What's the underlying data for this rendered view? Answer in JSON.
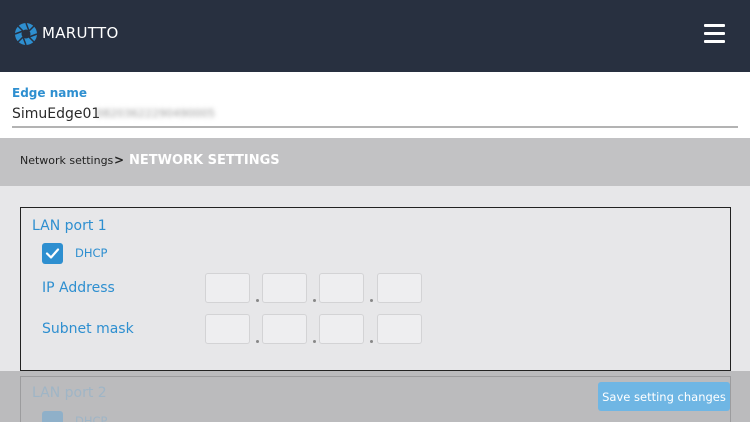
{
  "header": {
    "brand": "MARUTTO",
    "logo_icon": "aperture-logo-icon",
    "menu_icon": "hamburger-menu-icon",
    "bg_color": "#283040"
  },
  "edge": {
    "label": "Edge name",
    "name": "SimuEdge01",
    "id_masked": "08203622290490005"
  },
  "breadcrumb": {
    "link": "Network settings",
    "separator": ">",
    "current": "NETWORK SETTINGS"
  },
  "lan1": {
    "title": "LAN port 1",
    "dhcp_label": "DHCP",
    "dhcp_checked": true,
    "ip_label": "IP Address",
    "subnet_label": "Subnet mask",
    "ip": [
      "",
      "",
      "",
      ""
    ],
    "subnet": [
      "",
      "",
      "",
      ""
    ]
  },
  "lan2": {
    "title": "LAN port 2",
    "dhcp_label": "DHCP",
    "dhcp_checked": true
  },
  "actions": {
    "save_label": "Save setting changes"
  },
  "colors": {
    "accent": "#2e8fd0",
    "save_button": "#6fb6e4"
  }
}
